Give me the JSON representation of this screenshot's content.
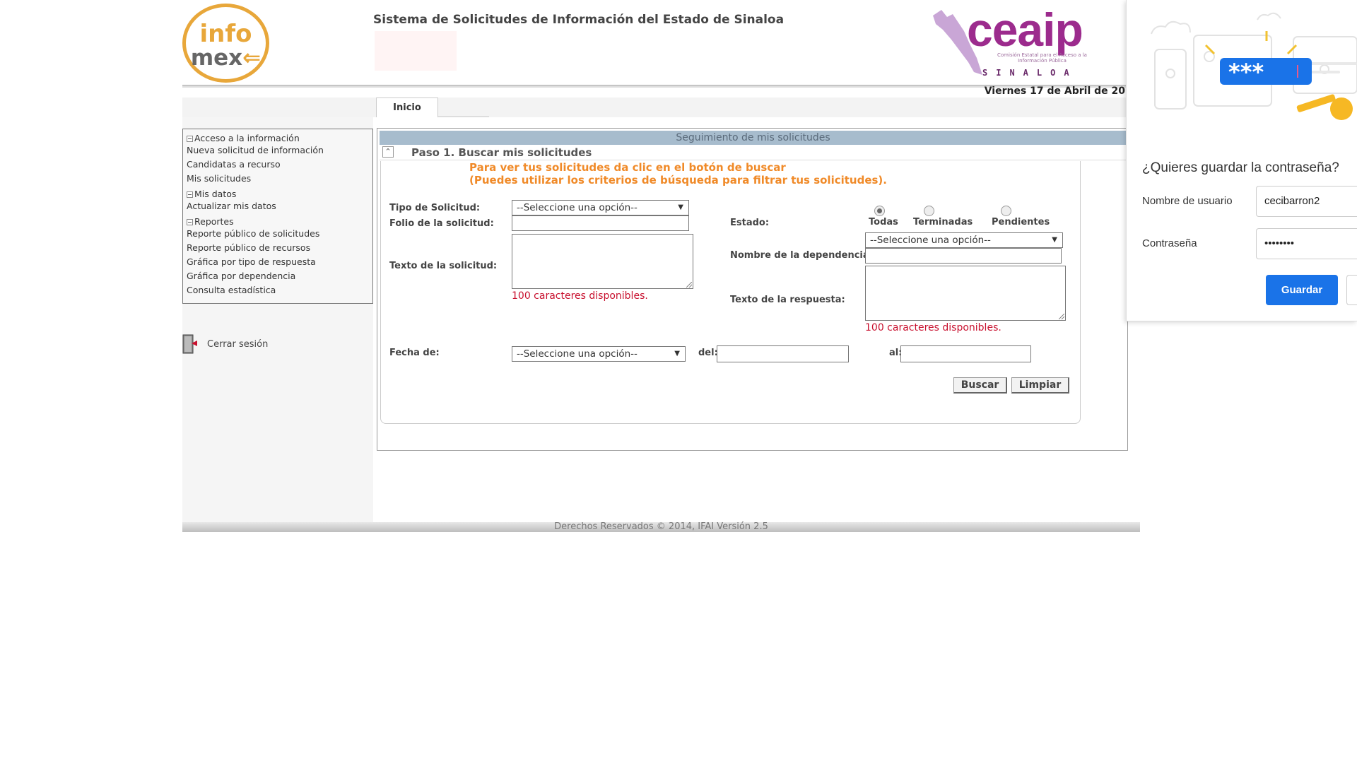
{
  "header": {
    "logo_line1": "info",
    "logo_line2": "mex",
    "system_title": "Sistema de Solicitudes de Información del Estado de Sinaloa",
    "ceaip_word": "ceaip",
    "ceaip_subtitle": "Comisión Estatal para el Acceso a la Información Pública",
    "ceaip_state": "SINALOA",
    "date": "Viernes 17 de Abril de 20"
  },
  "tabs": [
    {
      "label": "Inicio"
    }
  ],
  "menu": {
    "items": [
      {
        "label": "Acceso a la información",
        "type": "header"
      },
      {
        "label": "Nueva solicitud de información",
        "type": "link"
      },
      {
        "label": "Candidatas a recurso",
        "type": "link"
      },
      {
        "label": "Mis solicitudes",
        "type": "link"
      },
      {
        "label": "Mis datos",
        "type": "header"
      },
      {
        "label": "Actualizar mis datos",
        "type": "link"
      },
      {
        "label": "Reportes",
        "type": "header"
      },
      {
        "label": "Reporte público de solicitudes",
        "type": "link"
      },
      {
        "label": "Reporte público de recursos",
        "type": "link"
      },
      {
        "label": "Gráfica por tipo de respuesta",
        "type": "link"
      },
      {
        "label": "Gráfica por dependencia",
        "type": "link"
      },
      {
        "label": "Consulta estadística",
        "type": "link"
      }
    ],
    "logout_label": "Cerrar sesión"
  },
  "panel": {
    "header": "Seguimiento de mis solicitudes",
    "step_title": "Paso 1. Buscar mis solicitudes",
    "hint1": "Para ver tus solicitudes da clic en el botón de buscar",
    "hint2": "(Puedes utilizar los criterios de búsqueda para filtrar tus solicitudes).",
    "tipo_label": "Tipo de Solicitud:",
    "tipo_value": "--Seleccione una opción--",
    "folio_label": "Folio de la solicitud:",
    "folio_value": "",
    "texto_label": "Texto de la solicitud:",
    "counter1": "100 caracteres disponibles.",
    "estado_label": "Estado:",
    "estado_options": [
      {
        "label": "Todas",
        "selected": true
      },
      {
        "label": "Terminadas",
        "selected": false
      },
      {
        "label": "Pendientes",
        "selected": false
      }
    ],
    "dependencia_select_value": "--Seleccione una opción--",
    "dependencia_label": "Nombre de la dependencia:",
    "dependencia_value": "",
    "respuesta_label": "Texto de la respuesta:",
    "counter2": "100 caracteres disponibles.",
    "fecha_label": "Fecha de:",
    "fecha_value": "--Seleccione una opción--",
    "del_label": "del:",
    "del_value": "",
    "al_label": "al:",
    "al_value": "",
    "buscar_label": "Buscar",
    "limpiar_label": "Limpiar"
  },
  "footer": {
    "text": "Derechos Reservados © 2014, IFAI Versión 2.5"
  },
  "password_popup": {
    "illustration_stars": "***",
    "question": "¿Quieres guardar la contraseña?",
    "username_label": "Nombre de usuario",
    "username_value": "cecibarron2",
    "password_label": "Contraseña",
    "password_value": "••••••••",
    "save_label": "Guardar",
    "accent_color": "#1a73e8"
  }
}
